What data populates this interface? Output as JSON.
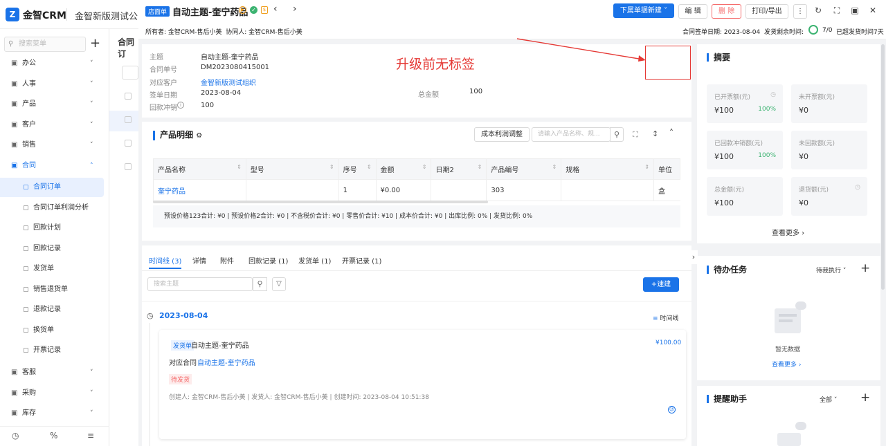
{
  "app": {
    "brand": "金智CRM",
    "tenant": "金智新版测试公司",
    "logo_letter": "Z"
  },
  "sidebar": {
    "search_placeholder": "搜索菜单",
    "menus": [
      {
        "label": "办公",
        "icon": "office-icon"
      },
      {
        "label": "人事",
        "icon": "person-icon"
      },
      {
        "label": "产品",
        "icon": "product-icon"
      },
      {
        "label": "客户",
        "icon": "customer-icon"
      },
      {
        "label": "销售",
        "icon": "sales-icon"
      },
      {
        "label": "合同",
        "icon": "contract-icon"
      }
    ],
    "submenus": [
      "合同订单",
      "合同订单利润分析",
      "回款计划",
      "回款记录",
      "发货单",
      "销售退货单",
      "退款记录",
      "换货单",
      "开票记录"
    ],
    "menus_after": [
      {
        "label": "客服",
        "icon": "service-icon"
      },
      {
        "label": "采购",
        "icon": "purchase-icon"
      },
      {
        "label": "库存",
        "icon": "stock-icon"
      }
    ],
    "bottom_icons": [
      "clock-icon",
      "percent-icon",
      "settings-icon"
    ],
    "bg_tab": "合同订"
  },
  "header": {
    "type_tag": "店面单",
    "title": "自动主题-奎宁药品",
    "dropdown_btn": "下属单据新建",
    "edit_btn": "编 辑",
    "delete_btn": "删 除",
    "print_btn": "打印/导出",
    "owner_label": "所有者:",
    "owner": "金智CRM-售后小美",
    "collab_label": "协同人:",
    "collab": "金智CRM-售后小美",
    "sign_date_label": "合同签单日期:",
    "sign_date": "2023-08-04",
    "remain_label": "发货剩余时间:",
    "remain_value": "7/0",
    "overdue": "已超发货时间7天"
  },
  "basic": {
    "fields": [
      {
        "label": "主题",
        "value": "自动主题-奎宁药品",
        "link": false
      },
      {
        "label": "合同单号",
        "value": "DM2023080415001",
        "link": false
      },
      {
        "label": "对应客户",
        "value": "金智新版测试组织",
        "link": true
      },
      {
        "label": "签单日期",
        "value": "2023-08-04",
        "link": false
      },
      {
        "label": "回款冲销",
        "value": "100",
        "link": false
      }
    ],
    "total_label": "总金额",
    "total_value": "100",
    "annotation": "升级前无标签",
    "annotation_color": "#e53935"
  },
  "products": {
    "title": "产品明细",
    "adjust_btn": "成本利润调整",
    "search_placeholder": "请输入产品名称、规...",
    "columns": [
      "产品名称",
      "型号",
      "序号",
      "金额",
      "日期2",
      "产品编号",
      "规格",
      "单位"
    ],
    "rows": [
      [
        "奎宁药品",
        "",
        "1",
        "¥0.00",
        "",
        "303",
        "",
        "盒"
      ]
    ],
    "summary": "预设价格123合计: ¥0 | 预设价格2合计: ¥0 | 不含税价合计: ¥0 | 零售价合计: ¥10 | 成本价合计: ¥0 | 出库比例: 0% | 发货比例: 0%"
  },
  "timeline": {
    "tabs": [
      "时间线 (3)",
      "详情",
      "附件",
      "回款记录 (1)",
      "发货单 (1)",
      "开票记录 (1)"
    ],
    "search_placeholder": "搜索主题",
    "quick_btn": "速建",
    "date": "2023-08-04",
    "view_label": "时间线",
    "entry": {
      "type": "发货单",
      "title": "自动主题-奎宁药品",
      "amount": "¥100.00",
      "contract_label": "对应合同",
      "contract": "自动主题-奎宁药品",
      "status": "待发货",
      "creator": "创建人: 金智CRM-售后小美",
      "shipper": "发货人: 金智CRM-售后小美",
      "created_at": "创建时间: 2023-08-04 10:51:38"
    }
  },
  "summary": {
    "title": "摘要",
    "boxes": [
      {
        "label": "已开票额(元)",
        "value": "¥100",
        "pct": "100%",
        "icon": true
      },
      {
        "label": "未开票额(元)",
        "value": "¥0",
        "pct": "",
        "icon": false
      },
      {
        "label": "已回款冲销额(元)",
        "value": "¥100",
        "pct": "100%",
        "icon": false
      },
      {
        "label": "未回款额(元)",
        "value": "¥0",
        "pct": "",
        "icon": false
      },
      {
        "label": "总金额(元)",
        "value": "¥100",
        "pct": "",
        "icon": false
      },
      {
        "label": "退货额(元)",
        "value": "¥0",
        "pct": "",
        "icon": true
      }
    ],
    "more": "查看更多"
  },
  "todo": {
    "title": "待办任务",
    "filter": "待我执行",
    "empty": "暂无数据",
    "more": "查看更多"
  },
  "reminder": {
    "title": "提醒助手",
    "filter": "全部"
  }
}
